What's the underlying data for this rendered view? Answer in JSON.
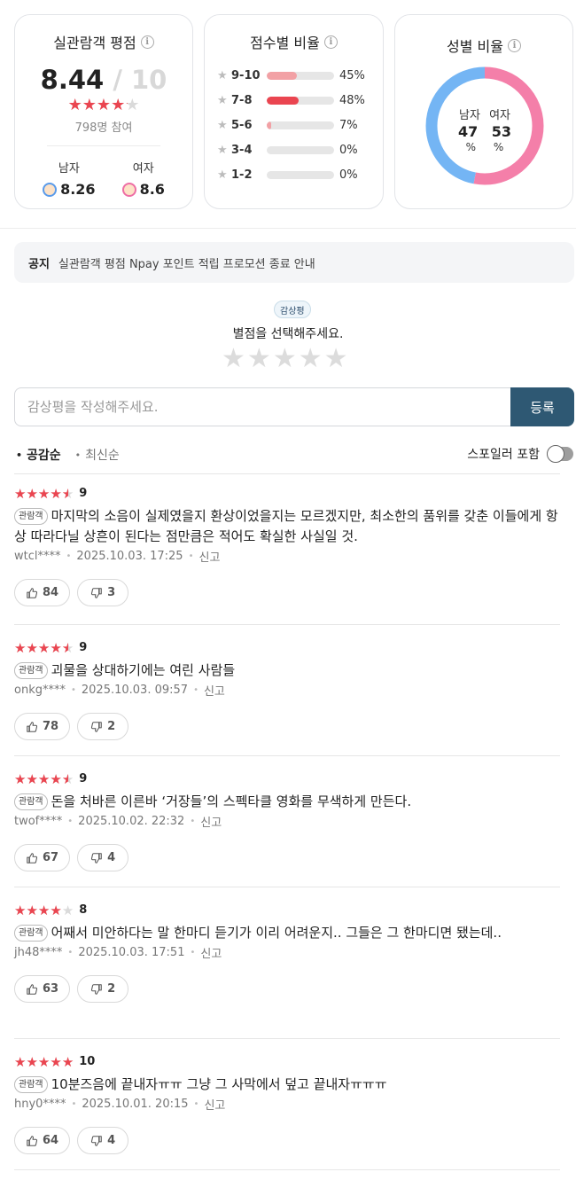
{
  "rating_card": {
    "title": "실관람객 평점",
    "score": "8.44",
    "out_of": "/ 10",
    "stars_filled": 4.2,
    "participants": "798명 참여",
    "male_label": "남자",
    "male_score": "8.26",
    "female_label": "여자",
    "female_score": "8.6"
  },
  "dist_card": {
    "title": "점수별 비율",
    "rows": [
      {
        "label": "9-10",
        "pct": "45%",
        "value": 45,
        "color": "#f2a1a5"
      },
      {
        "label": "7-8",
        "pct": "48%",
        "value": 48,
        "color": "#ea4550"
      },
      {
        "label": "5-6",
        "pct": "7%",
        "value": 7,
        "color": "#f2a1a5"
      },
      {
        "label": "3-4",
        "pct": "0%",
        "value": 0,
        "color": "#f2a1a5"
      },
      {
        "label": "1-2",
        "pct": "0%",
        "value": 0,
        "color": "#f2a1a5"
      }
    ]
  },
  "gender_card": {
    "title": "성별 비율",
    "male_label": "남자",
    "female_label": "여자",
    "male_value": "47",
    "female_value": "53",
    "male_pct": 47,
    "female_pct": 53,
    "pct_sign": "%",
    "male_color": "#74b5f4",
    "female_color": "#f47fa9"
  },
  "notice": {
    "tag": "공지",
    "text": "실관람객 평점 Npay 포인트 적립 프로모션 종료 안내"
  },
  "rate": {
    "badge": "감상평",
    "prompt": "별점을 선택해주세요.",
    "input_placeholder": "감상평을 작성해주세요.",
    "submit_label": "등록"
  },
  "sort": {
    "active": "공감순",
    "inactive": "최신순",
    "spoiler_label": "스포일러 포함"
  },
  "viewer_tag": "관람객",
  "report_label": "신고",
  "reviews": [
    {
      "stars": 4.5,
      "score": "9",
      "text": "마지막의 소음이 실제였을지 환상이었을지는 모르겠지만, 최소한의 품위를 갖춘 이들에게 항상 따라다닐 상흔이 된다는 점만큼은 적어도 확실한 사실일 것.",
      "user": "wtcl****",
      "date": "2025.10.03. 17:25",
      "likes": "84",
      "dislikes": "3"
    },
    {
      "stars": 4.5,
      "score": "9",
      "text": "괴물을 상대하기에는 여린 사람들",
      "user": "onkg****",
      "date": "2025.10.03. 09:57",
      "likes": "78",
      "dislikes": "2"
    },
    {
      "stars": 4.5,
      "score": "9",
      "text": "돈을 처바른 이른바 ‘거장들’의 스펙타클 영화를 무색하게 만든다.",
      "user": "twof****",
      "date": "2025.10.02. 22:32",
      "likes": "67",
      "dislikes": "4"
    },
    {
      "stars": 4,
      "score": "8",
      "text": "어째서 미안하다는 말 한마디 듣기가 이리 어려운지.. 그들은 그 한마디면 됐는데..",
      "user": "jh48****",
      "date": "2025.10.03. 17:51",
      "likes": "63",
      "dislikes": "2"
    },
    {
      "stars": 5,
      "score": "10",
      "text": "10분즈음에 끝내자ㅠㅠ 그냥 그 사막에서 덮고 끝내자ㅠㅠㅠ",
      "user": "hny0****",
      "date": "2025.10.01. 20:15",
      "likes": "64",
      "dislikes": "4"
    }
  ]
}
